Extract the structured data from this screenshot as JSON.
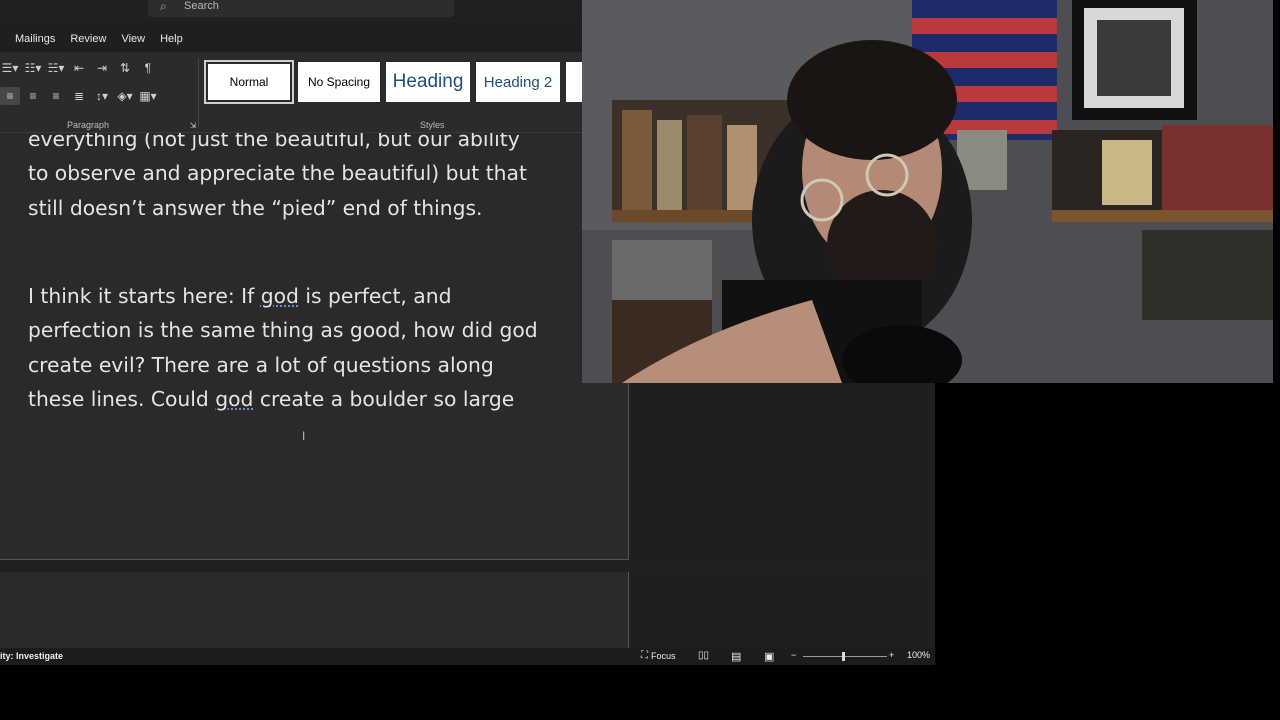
{
  "search": {
    "placeholder": "Search"
  },
  "menu": [
    "Mailings",
    "Review",
    "View",
    "Help"
  ],
  "ribbon": {
    "paragraph_label": "Paragraph",
    "styles_label": "Styles",
    "pilcrow": "¶"
  },
  "styles": [
    "Normal",
    "No Spacing",
    "Heading",
    "Heading 2"
  ],
  "document": {
    "para1": "everything (not just the beautiful, but our ability\nto observe and appreciate the beautiful) but that\nstill doesn’t answer the “pied” end of things.",
    "para2_a": "I think it starts here: If ",
    "para2_god1": "god",
    "para2_b": " is perfect, and\nperfection is the same thing as good, how did god\ncreate evil? There are a lot of questions along\nthese lines. Could ",
    "para2_god2": "god",
    "para2_c": " create a boulder so large"
  },
  "status": {
    "accessibility": "ity: Investigate",
    "focus": "Focus",
    "zoom": "100%"
  },
  "colors": {
    "background": "#1f1f1f",
    "page": "#2a2a2a",
    "ribbon": "#2b2b2b",
    "heading": "#1e4e79"
  }
}
